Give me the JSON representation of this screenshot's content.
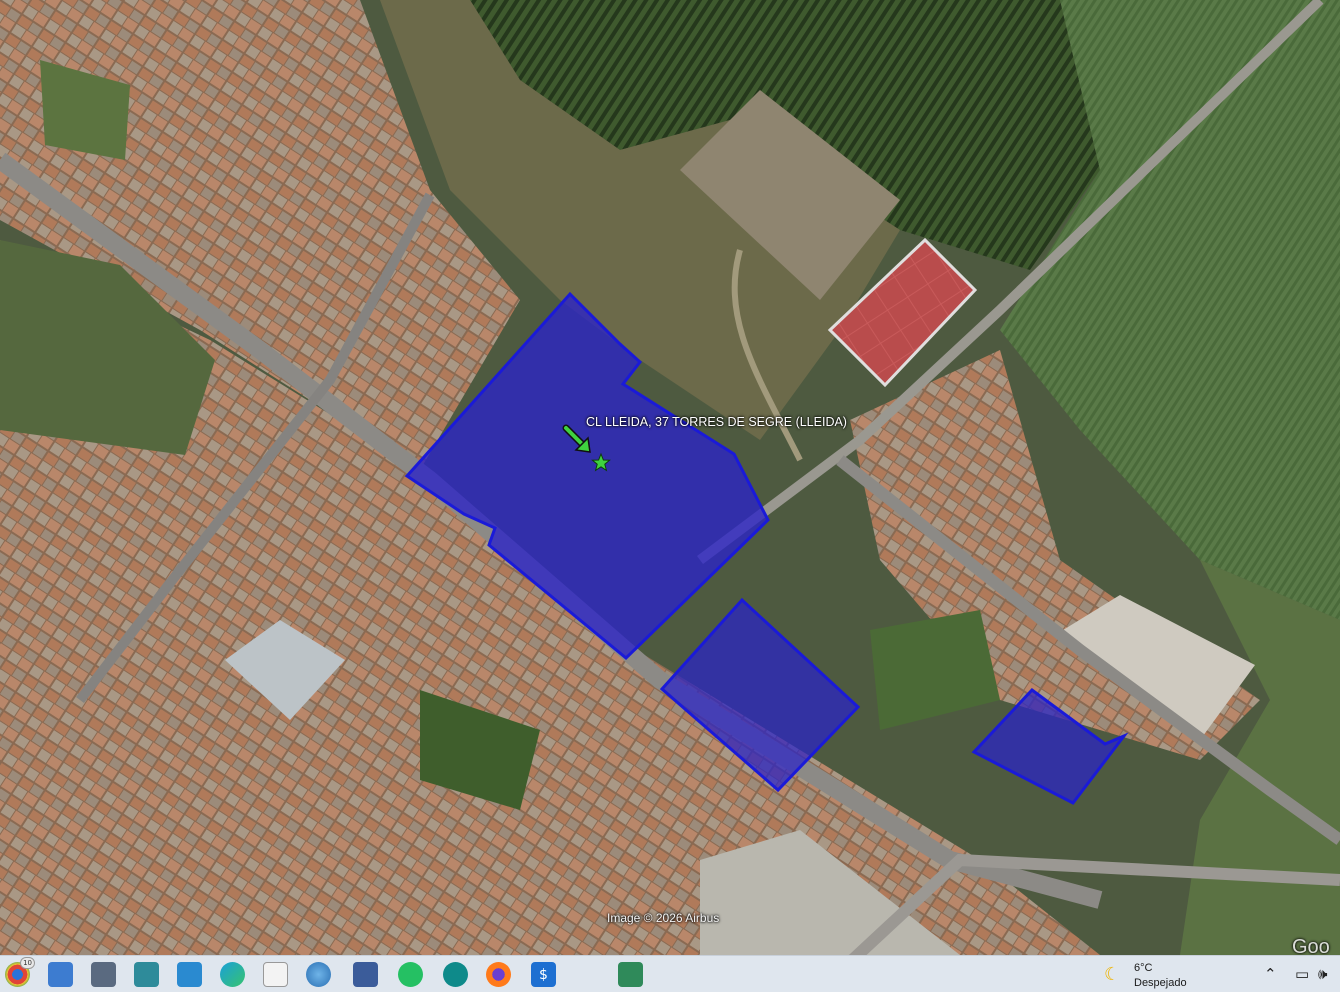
{
  "map": {
    "type": "satellite",
    "place_label": "CL LLEIDA, 37  TORRES DE SEGRE (LLEIDA)",
    "attribution": "Image © 2026 Airbus",
    "provider_mark": "Goo",
    "highlight_color": "#1a1ad8",
    "highlight_fill": "#2a22c8",
    "marker_color": "#3fd23f"
  },
  "taskbar": {
    "apps": [
      {
        "name": "chrome-icon",
        "glyph": "",
        "badge": "10"
      },
      {
        "name": "photos-icon",
        "glyph": ""
      },
      {
        "name": "snipping-tool-icon",
        "glyph": ""
      },
      {
        "name": "secure-files-icon",
        "glyph": ""
      },
      {
        "name": "gallery-icon",
        "glyph": ""
      },
      {
        "name": "edge-icon",
        "glyph": ""
      },
      {
        "name": "notepad-icon",
        "glyph": ""
      },
      {
        "name": "globe-icon",
        "glyph": ""
      },
      {
        "name": "save-disk-icon",
        "glyph": ""
      },
      {
        "name": "whatsapp-icon",
        "glyph": ""
      },
      {
        "name": "wifi-app-icon",
        "glyph": ""
      },
      {
        "name": "firefox-icon",
        "glyph": ""
      },
      {
        "name": "dollar-app-icon",
        "glyph": "$"
      },
      {
        "name": "arrow-app-icon",
        "glyph": ""
      },
      {
        "name": "window-app-icon",
        "glyph": ""
      }
    ],
    "weather": {
      "temp": "6°C",
      "condition": "Despejado",
      "icon": "moon-icon"
    },
    "tray": {
      "chevron": "⌃",
      "display": "▭",
      "volume": "🕪"
    }
  }
}
